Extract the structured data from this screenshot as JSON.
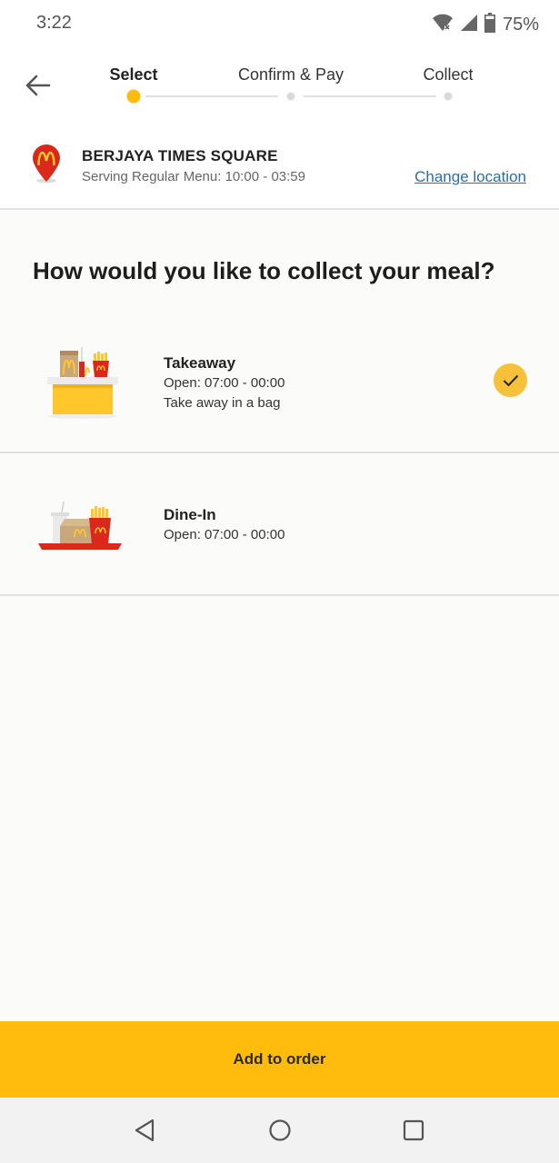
{
  "status_bar": {
    "time": "3:22",
    "battery": "75%",
    "icons": [
      "wifi-icon",
      "signal-icon",
      "battery-icon"
    ]
  },
  "header": {
    "back_icon": "arrow-left-icon",
    "steps": [
      {
        "label": "Select",
        "active": true
      },
      {
        "label": "Confirm & Pay",
        "active": false
      },
      {
        "label": "Collect",
        "active": false
      }
    ]
  },
  "location": {
    "icon": "mcdonalds-pin-icon",
    "store_name": "BERJAYA TIMES SQUARE",
    "hours": "Serving Regular Menu: 10:00 - 03:59",
    "change_label": "Change location"
  },
  "question": "How would you like to collect your meal?",
  "options": [
    {
      "title": "Takeaway",
      "hours": "Open: 07:00 - 00:00",
      "note": "Take away in a bag",
      "selected": true,
      "icon": "takeaway-counter-icon"
    },
    {
      "title": "Dine-In",
      "hours": "Open: 07:00 - 00:00",
      "note": "",
      "selected": false,
      "icon": "dine-in-tray-icon"
    }
  ],
  "add_button": "Add to order",
  "nav": {
    "back_icon": "nav-back-icon",
    "home_icon": "nav-home-icon",
    "recents_icon": "nav-recents-icon"
  },
  "colors": {
    "accent": "#ffbc0d",
    "check": "#f7c23a",
    "link": "#2a6fa8",
    "brand_red": "#da291c"
  }
}
